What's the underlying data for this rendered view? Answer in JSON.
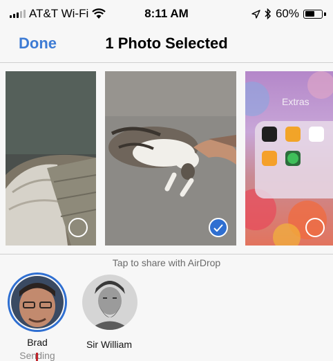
{
  "status_bar": {
    "carrier": "AT&T Wi-Fi",
    "time": "8:11 AM",
    "battery_percent": "60%",
    "battery_level": 0.6,
    "icons": [
      "signal-bars-icon",
      "wifi-icon",
      "location-arrow-icon",
      "bluetooth-icon",
      "battery-icon"
    ]
  },
  "navbar": {
    "done_label": "Done",
    "title": "1 Photo Selected"
  },
  "photos": [
    {
      "description_icon": "photo-pillows",
      "selected": false
    },
    {
      "description_icon": "photo-cat",
      "selected": true
    },
    {
      "description_icon": "photo-home-screen-extras",
      "selected": false,
      "folder_label": "Extras"
    }
  ],
  "airdrop": {
    "hint": "Tap to share with AirDrop",
    "contacts": [
      {
        "name": "Brad",
        "status": "Sending"
      },
      {
        "name": "Sir William",
        "status": ""
      }
    ]
  },
  "colors": {
    "accent": "#3d7bd4",
    "selected_check": "#2f6fd1",
    "background": "#f7f7f7"
  }
}
